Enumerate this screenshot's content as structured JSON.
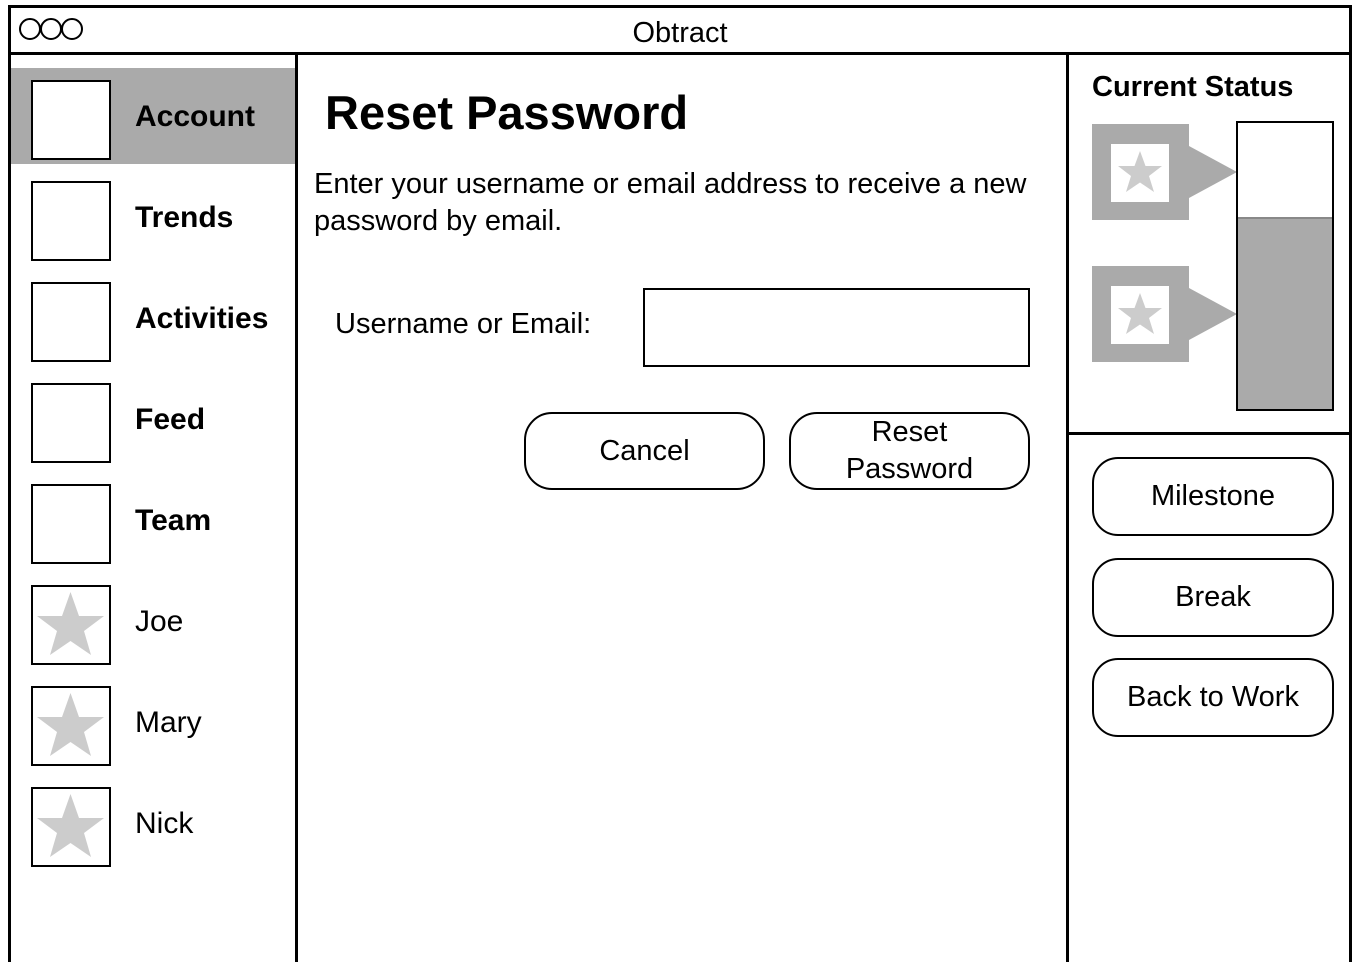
{
  "window": {
    "title": "Obtract"
  },
  "sidebar": {
    "items": [
      {
        "label": "Account",
        "icon": "image-placeholder",
        "bold": true,
        "active": true
      },
      {
        "label": "Trends",
        "icon": "image-placeholder",
        "bold": true,
        "active": false
      },
      {
        "label": "Activities",
        "icon": "image-placeholder",
        "bold": true,
        "active": false
      },
      {
        "label": "Feed",
        "icon": "image-placeholder",
        "bold": true,
        "active": false
      },
      {
        "label": "Team",
        "icon": "image-placeholder",
        "bold": true,
        "active": false
      },
      {
        "label": "Joe",
        "icon": "star-icon",
        "bold": false,
        "active": false
      },
      {
        "label": "Mary",
        "icon": "star-icon",
        "bold": false,
        "active": false
      },
      {
        "label": "Nick",
        "icon": "star-icon",
        "bold": false,
        "active": false
      }
    ]
  },
  "main": {
    "title": "Reset Password",
    "description": "Enter your username or email address to receive a new password by email.",
    "field": {
      "label": "Username or Email:",
      "value": "",
      "placeholder": ""
    },
    "cancel_label": "Cancel",
    "reset_label": "Reset Password"
  },
  "status": {
    "title": "Current Status",
    "tokens": [
      {
        "icon": "star-icon"
      },
      {
        "icon": "star-icon"
      }
    ],
    "progress_fraction": 0.67,
    "buttons": [
      "Milestone",
      "Break",
      "Back to Work"
    ]
  },
  "colors": {
    "accent_gray": "#aaaaaa",
    "star_gray": "#cccccc",
    "border": "#000000"
  }
}
